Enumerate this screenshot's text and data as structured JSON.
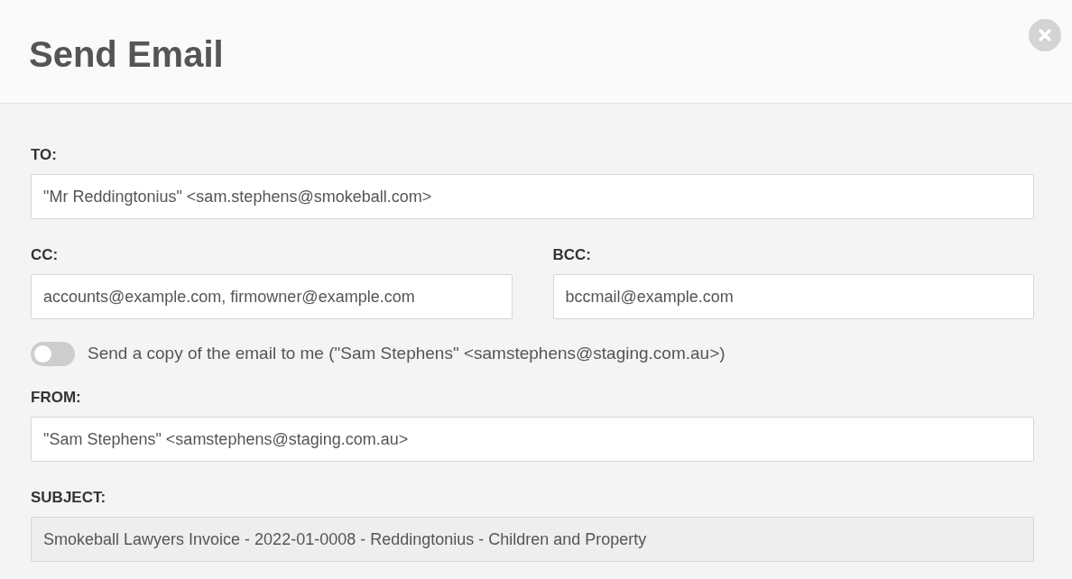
{
  "dialog": {
    "title": "Send Email"
  },
  "to": {
    "label": "TO:",
    "value": "\"Mr Reddingtonius\" <sam.stephens@smokeball.com>",
    "disabled": false
  },
  "cc": {
    "label": "CC:",
    "value": "accounts@example.com, firmowner@example.com",
    "disabled": false
  },
  "bcc": {
    "label": "BCC:",
    "value": "bccmail@example.com",
    "disabled": false
  },
  "copy_toggle": {
    "label": "Send a copy of the email to me (\"Sam Stephens\" <samstephens@staging.com.au>)",
    "on": false
  },
  "from": {
    "label": "FROM:",
    "value": "\"Sam Stephens\" <samstephens@staging.com.au>",
    "disabled": false
  },
  "subject": {
    "label": "SUBJECT:",
    "value": "Smokeball Lawyers Invoice - 2022-01-0008 - Reddingtonius - Children and Property",
    "disabled": true
  }
}
